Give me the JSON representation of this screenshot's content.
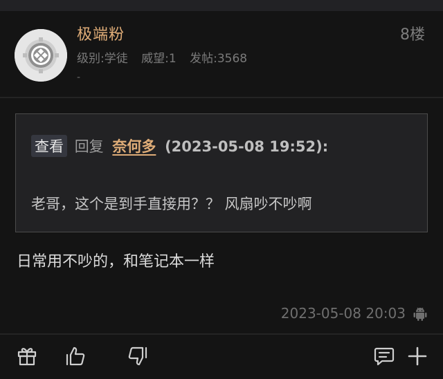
{
  "post": {
    "username": "极端粉",
    "floor": "8楼",
    "meta": {
      "level": "级别:学徒",
      "prestige": "威望:1",
      "posts": "发帖:3568"
    },
    "signature": "-",
    "quote": {
      "view_label": "查看",
      "reply_label": "回复",
      "reply_user": "奈何多",
      "reply_time": "(2023-05-08 19:52):",
      "text": "老哥，这个是到手直接用？？ 风扇吵不吵啊"
    },
    "content": "日常用不吵的，和笔记本一样",
    "timestamp": "2023-05-08 20:03"
  },
  "icons": {
    "avatar": "default-avatar-icon",
    "platform": "android-icon",
    "gift": "gift-icon",
    "like": "thumbs-up-icon",
    "dislike": "thumbs-down-icon",
    "comment": "comment-icon",
    "more": "plus-icon"
  },
  "colors": {
    "username": "#e0ad78",
    "background": "#141414",
    "quote_bg": "#222224",
    "muted": "#7a7a7a"
  }
}
